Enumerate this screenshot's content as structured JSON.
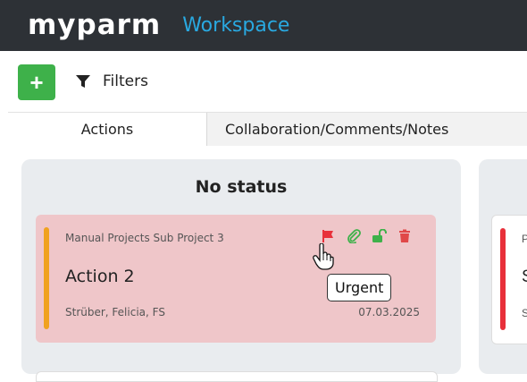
{
  "header": {
    "logo": "myparm",
    "workspace": "Workspace"
  },
  "toolbar": {
    "add_label": "+",
    "filters_label": "Filters"
  },
  "tabs": [
    {
      "label": "Actions",
      "active": true
    },
    {
      "label": "Collaboration/Comments/Notes",
      "active": false
    }
  ],
  "columns": [
    {
      "title": "No status",
      "cards": [
        {
          "project": "Manual Projects Sub Project 3",
          "title": "Action 2",
          "assignee": "Strüber, Felicia, FS",
          "date": "07.03.2025",
          "stripe_color": "#f0a21f",
          "background": "#efc6c9",
          "icons": [
            "flag-icon",
            "paperclip-icon",
            "unlock-icon",
            "trash-icon"
          ]
        }
      ]
    },
    {
      "title": "",
      "cards": [
        {
          "project": "P",
          "title": "S",
          "assignee": "S",
          "stripe_color": "#e8303a"
        }
      ]
    }
  ],
  "tooltip": "Urgent",
  "colors": {
    "header_bg": "#2d3136",
    "workspace": "#29a9e1",
    "add_button": "#3eb14a",
    "flag": "#e8303a",
    "paperclip": "#3eb14a",
    "unlock": "#3eb14a",
    "trash": "#e04848"
  }
}
